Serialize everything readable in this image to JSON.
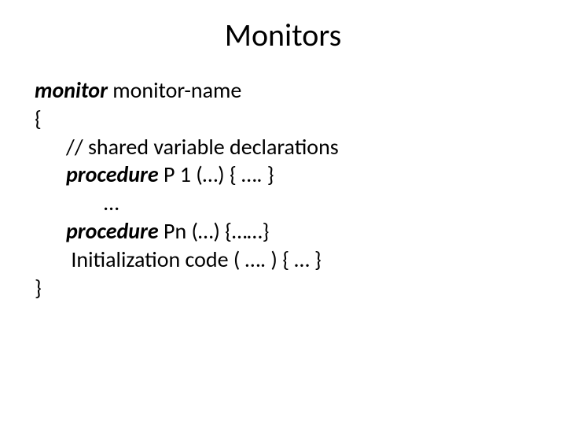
{
  "title": "Monitors",
  "code": {
    "l1_kw": "monitor",
    "l1_rest": " monitor-name",
    "l2": "{",
    "l3": "// shared variable declarations",
    "l4_kw": "procedure",
    "l4_rest": " P 1 (…) { …. }",
    "l5": "…",
    "l6_kw": "procedure",
    "l6_rest": " Pn (…) {……}",
    "l7": " Initialization code ( …. ) { … }",
    "l8": "}"
  }
}
